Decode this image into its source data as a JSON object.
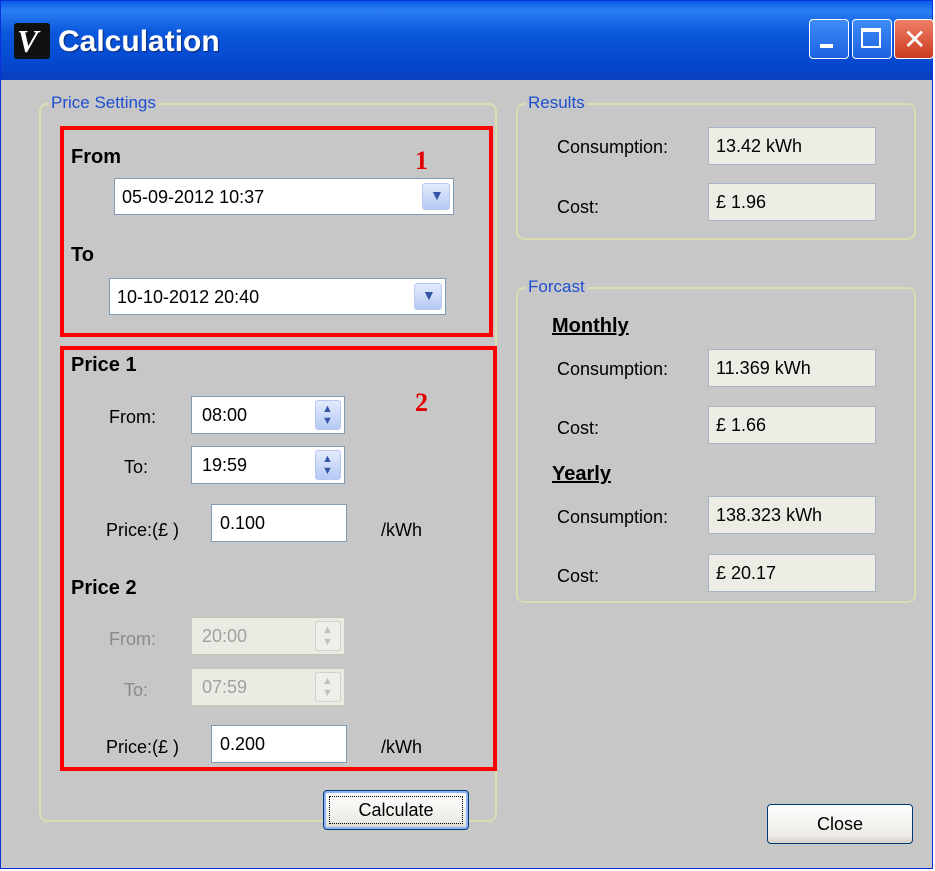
{
  "window": {
    "title": "Calculation",
    "icon": "V",
    "icon_name": "app-logo-icon"
  },
  "price_settings": {
    "legend": "Price Settings",
    "from_label": "From",
    "from_value": "05-09-2012 10:37",
    "to_label": "To",
    "to_value": "10-10-2012 20:40",
    "price1": {
      "heading": "Price 1",
      "from_label": "From:",
      "from_value": "08:00",
      "to_label": "To:",
      "to_value": "19:59",
      "price_label": "Price:(£ )",
      "price_value": "0.100",
      "unit": "/kWh"
    },
    "price2": {
      "heading": "Price 2",
      "from_label": "From:",
      "from_value": "20:00",
      "to_label": "To:",
      "to_value": "07:59",
      "price_label": "Price:(£ )",
      "price_value": "0.200",
      "unit": "/kWh"
    },
    "calculate_label": "Calculate"
  },
  "results": {
    "legend": "Results",
    "consumption_label": "Consumption:",
    "consumption_value": "13.42 kWh",
    "cost_label": "Cost:",
    "cost_value": "£ 1.96"
  },
  "forecast": {
    "legend": "Forcast",
    "monthly_heading": "Monthly",
    "monthly_consumption_label": "Consumption:",
    "monthly_consumption_value": "11.369 kWh",
    "monthly_cost_label": "Cost:",
    "monthly_cost_value": "£ 1.66",
    "yearly_heading": "Yearly",
    "yearly_consumption_label": "Consumption:",
    "yearly_consumption_value": "138.323 kWh",
    "yearly_cost_label": "Cost:",
    "yearly_cost_value": "£ 20.17"
  },
  "close_label": "Close",
  "annotations": {
    "box1": "1",
    "box2": "2",
    "color": "#ff0000"
  },
  "colors": {
    "titlebar": "#0b58dc",
    "legend": "#1f4fd0",
    "window_bg": "#c7c7c7"
  }
}
